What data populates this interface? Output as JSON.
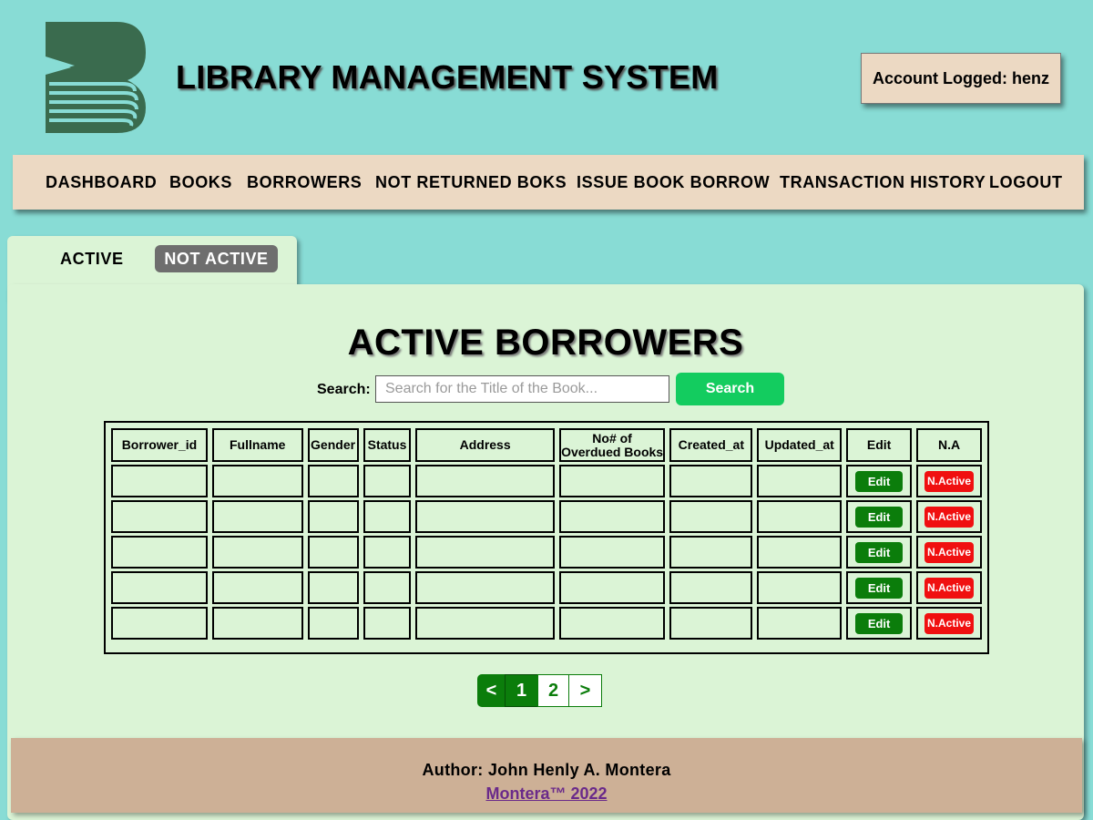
{
  "header": {
    "title": "LIBRARY MANAGEMENT SYSTEM",
    "account": "Account Logged: henz",
    "logo_icon": "book-b-logo-icon",
    "logo_color": "#3a6b4e"
  },
  "nav": {
    "items": [
      {
        "label": "DASHBOARD"
      },
      {
        "label": "BOOKS"
      },
      {
        "label": "BORROWERS"
      },
      {
        "label": "NOT RETURNED BOKS"
      },
      {
        "label": "ISSUE BOOK BORROW"
      },
      {
        "label": "TRANSACTION HISTORY"
      },
      {
        "label": "LOGOUT"
      }
    ]
  },
  "tabs": {
    "active": "ACTIVE",
    "not_active": "NOT ACTIVE"
  },
  "main": {
    "title": "ACTIVE BORROWERS",
    "search_label": "Search:",
    "search_placeholder": "Search for the Title of the Book...",
    "search_button": "Search"
  },
  "table": {
    "headers": [
      "Borrower_id",
      "Fullname",
      "Gender",
      "Status",
      "Address",
      "No# of Overdued Books",
      "Created_at",
      "Updated_at",
      "Edit",
      "N.A"
    ],
    "edit_label": "Edit",
    "na_label": "N.Active"
  },
  "pagination": {
    "prev": "<",
    "pages": [
      "1",
      "2"
    ],
    "current": "1",
    "next": ">"
  },
  "footer": {
    "author": "Author: John Henly A. Montera",
    "link": "Montera™ 2022"
  },
  "colors": {
    "background": "#88dcd5",
    "panel": "#dbf4d6",
    "nav": "#ecd9c3",
    "footer": "#cdb096",
    "search_button": "#13cc5f",
    "edit_button": "#0b7d0b",
    "na_button": "#f01010"
  }
}
